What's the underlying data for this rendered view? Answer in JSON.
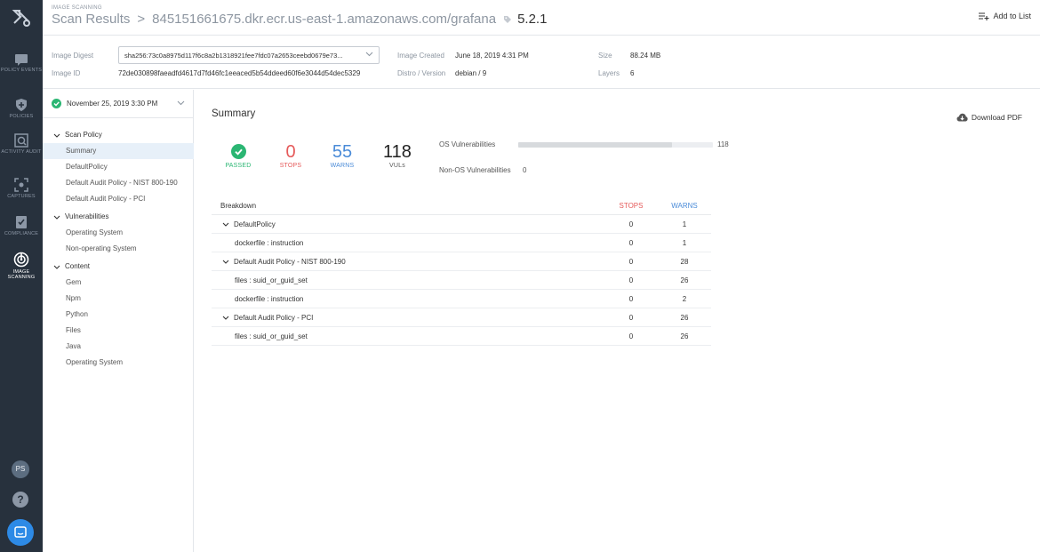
{
  "rail": {
    "items": [
      {
        "label": "POLICY EVENTS",
        "icon": "message-icon"
      },
      {
        "label": "POLICIES",
        "icon": "shield-icon"
      },
      {
        "label": "ACTIVITY AUDIT",
        "icon": "activity-audit-icon"
      },
      {
        "label": "CAPTURES",
        "icon": "capture-icon"
      },
      {
        "label": "COMPLIANCE",
        "icon": "compliance-icon"
      },
      {
        "label": "IMAGE SCANNING",
        "icon": "radar-icon"
      }
    ],
    "avatar_initials": "PS",
    "help_glyph": "?"
  },
  "header": {
    "eyebrow": "IMAGE SCANNING",
    "section": "Scan Results",
    "separator": ">",
    "repository": "845151661675.dkr.ecr.us-east-1.amazonaws.com/grafana",
    "tag": "5.2.1",
    "add_to_list_label": "Add to List"
  },
  "meta": {
    "image_digest_label": "Image Digest",
    "image_digest_value": "sha256:73c0a8975d117f6c8a2b1318921fee7fdc07a2653ceebd0679e73...",
    "image_id_label": "Image ID",
    "image_id_value": "72de030898faeadfd4617d7fd46fc1eeaced5b54ddeed60f6e3044d54dec5329",
    "image_created_label": "Image Created",
    "image_created_value": "June 18, 2019 4:31 PM",
    "distro_label": "Distro / Version",
    "distro_value": "debian / 9",
    "size_label": "Size",
    "size_value": "88.24 MB",
    "layers_label": "Layers",
    "layers_value": "6"
  },
  "subnav": {
    "scan_date": "November 25, 2019 3:30 PM",
    "groups": [
      {
        "title": "Scan Policy",
        "items": [
          "Summary",
          "DefaultPolicy",
          "Default Audit Policy - NIST 800-190",
          "Default Audit Policy - PCI"
        ]
      },
      {
        "title": "Vulnerabilities",
        "items": [
          "Operating System",
          "Non-operating System"
        ]
      },
      {
        "title": "Content",
        "items": [
          "Gem",
          "Npm",
          "Python",
          "Files",
          "Java",
          "Operating System"
        ]
      }
    ]
  },
  "summary": {
    "title": "Summary",
    "download_label": "Download PDF",
    "passed_label": "PASSED",
    "stops_value": "0",
    "stops_label": "STOPS",
    "warns_value": "55",
    "warns_label": "WARNS",
    "vuls_value": "118",
    "vuls_label": "VULs",
    "os_vuln_label": "OS Vulnerabilities",
    "os_vuln_value": "118",
    "os_vuln_fill_fraction": 0.79,
    "non_os_vuln_label": "Non-OS Vulnerabilities",
    "non_os_vuln_value": "0",
    "colors": {
      "passed": "#2bb673",
      "stops": "#e55a5a",
      "warns": "#4a8bd8"
    }
  },
  "breakdown": {
    "header": {
      "name": "Breakdown",
      "stops": "STOPS",
      "warns": "WARNS"
    },
    "rows": [
      {
        "name": "DefaultPolicy",
        "level": "parent",
        "stops": "0",
        "warns": "1"
      },
      {
        "name": "dockerfile : instruction",
        "level": "child",
        "stops": "0",
        "warns": "1"
      },
      {
        "name": "Default Audit Policy - NIST 800-190",
        "level": "parent",
        "stops": "0",
        "warns": "28"
      },
      {
        "name": "files : suid_or_guid_set",
        "level": "child",
        "stops": "0",
        "warns": "26"
      },
      {
        "name": "dockerfile : instruction",
        "level": "child",
        "stops": "0",
        "warns": "2"
      },
      {
        "name": "Default Audit Policy - PCI",
        "level": "parent",
        "stops": "0",
        "warns": "26"
      },
      {
        "name": "files : suid_or_guid_set",
        "level": "child",
        "stops": "0",
        "warns": "26"
      }
    ]
  }
}
